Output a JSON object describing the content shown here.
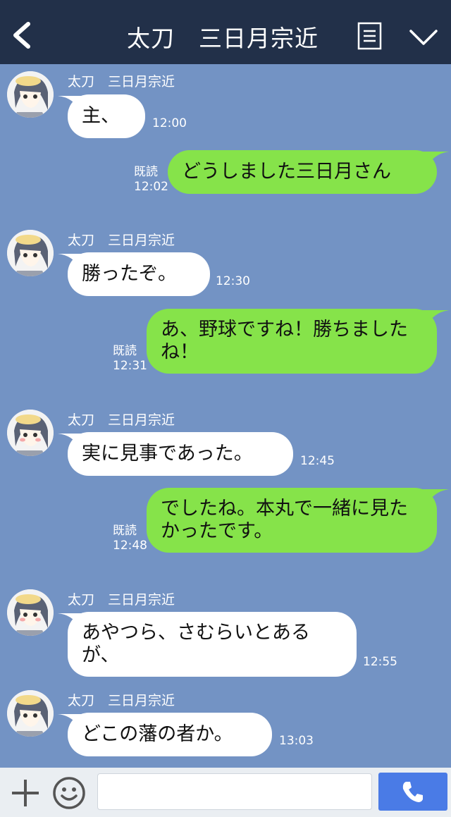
{
  "header": {
    "title": "太刀　三日月宗近",
    "icons": [
      "back-chevron-icon",
      "menu-icon",
      "chevron-down-icon"
    ],
    "color": "#223049"
  },
  "sender_name": "太刀　三日月宗近",
  "read_label": "既読",
  "messages": [
    {
      "side": "in",
      "text": "主、",
      "time": "12:00"
    },
    {
      "side": "out",
      "text": "どうしました三日月さん",
      "time": "12:02",
      "read": true
    },
    {
      "side": "in",
      "text": "勝ったぞ。",
      "time": "12:30"
    },
    {
      "side": "out",
      "text": "あ、野球ですね！勝ちましたね！",
      "time": "12:31",
      "read": true
    },
    {
      "side": "in",
      "text": "実に見事であった。",
      "time": "12:45"
    },
    {
      "side": "out",
      "text": "でしたね。本丸で一緒に見たかったです。",
      "time": "12:48",
      "read": true
    },
    {
      "side": "in",
      "text": "あやつら、さむらいとあるが、",
      "time": "12:55"
    },
    {
      "side": "in",
      "text": "どこの藩の者か。",
      "time": "13:03"
    }
  ],
  "footer": {
    "input_placeholder": "",
    "icons": [
      "plus-icon",
      "smiley-icon",
      "phone-icon"
    ]
  },
  "colors": {
    "background": "#7393c4",
    "outgoing_bubble": "#86e34a",
    "incoming_bubble": "#ffffff",
    "call_button": "#4a7be6"
  }
}
